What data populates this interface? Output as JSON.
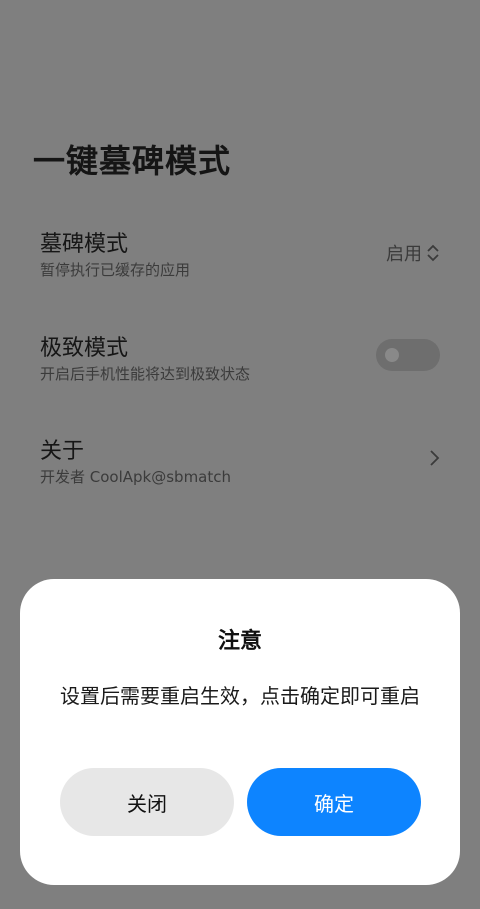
{
  "page": {
    "title": "一键墓碑模式"
  },
  "settings": [
    {
      "title": "墓碑模式",
      "subtitle": "暂停执行已缓存的应用",
      "value": "启用"
    },
    {
      "title": "极致模式",
      "subtitle": "开启后手机性能将达到极致状态",
      "toggle_on": false
    },
    {
      "title": "关于",
      "subtitle": "开发者 CoolApk@sbmatch"
    }
  ],
  "dialog": {
    "title": "注意",
    "message": "设置后需要重启生效，点击确定即可重启",
    "close_label": "关闭",
    "confirm_label": "确定"
  },
  "colors": {
    "overlay": "#7f7f7f",
    "dialog_bg": "#ffffff",
    "confirm": "#0d84ff",
    "close": "#e7e7e7"
  }
}
